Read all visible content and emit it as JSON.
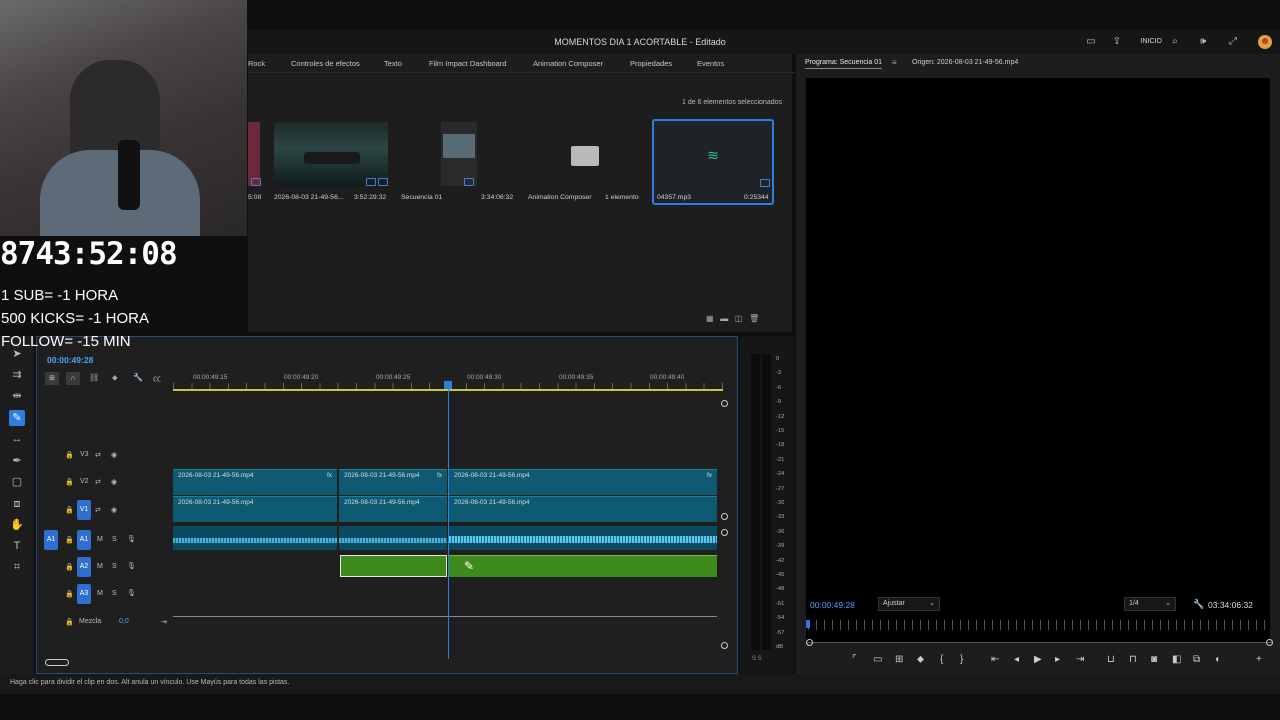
{
  "app_title": "MOMENTOS DIA 1 ACORTABLE - Editado",
  "workspace": {
    "label": "INICIO"
  },
  "project_tabs": [
    "Rock",
    "Controles de efectos",
    "Texto",
    "Film Impact Dashboard",
    "Animation Composer",
    "Propiedades",
    "Eventos"
  ],
  "project": {
    "selection_count": "1 de 6 elementos seleccionados",
    "items": [
      {
        "name": "5:08",
        "duration": ""
      },
      {
        "name": "2026-08-03 21-49-56...",
        "duration": "3:52:29:32"
      },
      {
        "name": "Secuencia 01",
        "duration": "3:34:06:32"
      },
      {
        "name": "Animation Composer",
        "duration": "1 elemento"
      },
      {
        "name": "04357.mp3",
        "duration": "0:25344"
      }
    ]
  },
  "program": {
    "tab_program": "Programa: Secuencia 01",
    "tab_source": "Origen: 2026-08-03 21-49-56.mp4",
    "timecode": "00:00:49:28",
    "fit": "Ajustar",
    "resolution": "1/4",
    "duration": "03:34:06:32"
  },
  "timeline": {
    "timecode": "00:00:49:28",
    "ruler": [
      "00:00:49:15",
      "00:00:49:20",
      "00:00:49:25",
      "00:00:49:30",
      "00:00:49:35",
      "00:00:49:40"
    ],
    "tracks": {
      "v3": "V3",
      "v2": "V2",
      "v1": "V1",
      "a1": "A1",
      "a2": "A2",
      "a3": "A3"
    },
    "mix_label": "Mezcla",
    "mix_value": "0,0",
    "clip_name": "2026-08-03 21-49-56.mp4",
    "fx": "fx"
  },
  "meter_labels": [
    "0",
    "-3",
    "-6",
    "-9",
    "-12",
    "-15",
    "-18",
    "-21",
    "-24",
    "-27",
    "-30",
    "-33",
    "-36",
    "-39",
    "-42",
    "-45",
    "-48",
    "-51",
    "-54",
    "-57",
    "dB"
  ],
  "meter_foot": "S S",
  "status": "Haga clic para dividir el clip en dos. Alt anula un vínculo. Use Mayús para todas las pistas.",
  "stream_overlay": {
    "timer": "8743:52:08",
    "lines": [
      "1 SUB= -1 HORA",
      "500 KICKS= -1 HORA",
      "FOLLOW= -15 MIN"
    ]
  },
  "colors": {
    "accent": "#2f7de1",
    "video_clip": "#0e5a73",
    "audio_clip": "#3f8a1c",
    "timecode": "#4aa3ff"
  }
}
